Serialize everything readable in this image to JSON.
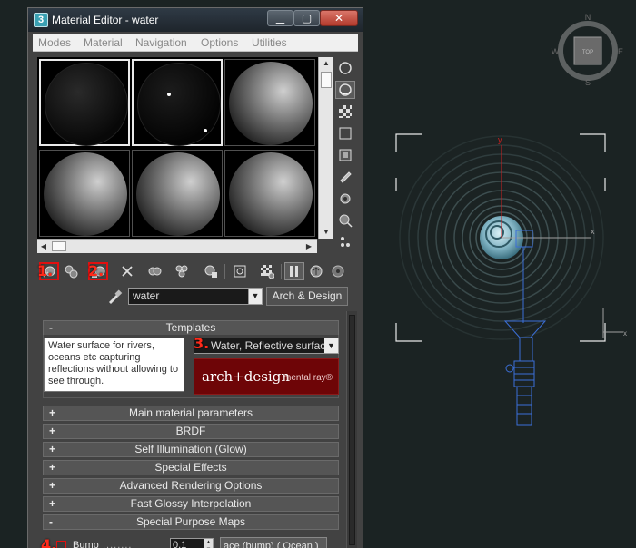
{
  "window": {
    "title": "Material Editor - water",
    "title_icon_glyph": "3",
    "minimize_glyph": "▁",
    "maximize_glyph": "▢",
    "close_glyph": "✕"
  },
  "menu": [
    "Modes",
    "Material",
    "Navigation",
    "Options",
    "Utilities"
  ],
  "toolbar_markers": {
    "m1": "1.",
    "m2": "2.",
    "m3": "3.",
    "m4": "4."
  },
  "material": {
    "name": "water",
    "type_button": "Arch & Design"
  },
  "templates": {
    "header": "Templates",
    "sign": "-",
    "description": "Water surface for rivers, oceans etc capturing reflections without allowing to see through.",
    "selected": "Water, Reflective surface",
    "logo_main": "arch+design",
    "logo_sub": "mental ray®"
  },
  "rollouts": [
    {
      "sign": "+",
      "label": "Main material parameters"
    },
    {
      "sign": "+",
      "label": "BRDF"
    },
    {
      "sign": "+",
      "label": "Self Illumination (Glow)"
    },
    {
      "sign": "+",
      "label": "Special Effects"
    },
    {
      "sign": "+",
      "label": "Advanced Rendering Options"
    },
    {
      "sign": "+",
      "label": "Fast Glossy Interpolation"
    },
    {
      "sign": "-",
      "label": "Special Purpose Maps"
    }
  ],
  "bump": {
    "label": "Bump",
    "dots": "........",
    "value": "0,1",
    "map": "ace (bump)  ( Ocean )"
  },
  "viewcube": {
    "top_label": "TOP",
    "compass": {
      "n": "N",
      "s": "S",
      "e": "E",
      "w": "W"
    }
  },
  "gizmo_labels": {
    "x": "x",
    "y": "y"
  },
  "colors": {
    "viewport_bg": "#1b2323",
    "ui_panel": "#424242",
    "marker_red": "#ff2a1a",
    "logo_red": "#6e0507",
    "selection_blue": "#3b6fd8"
  }
}
